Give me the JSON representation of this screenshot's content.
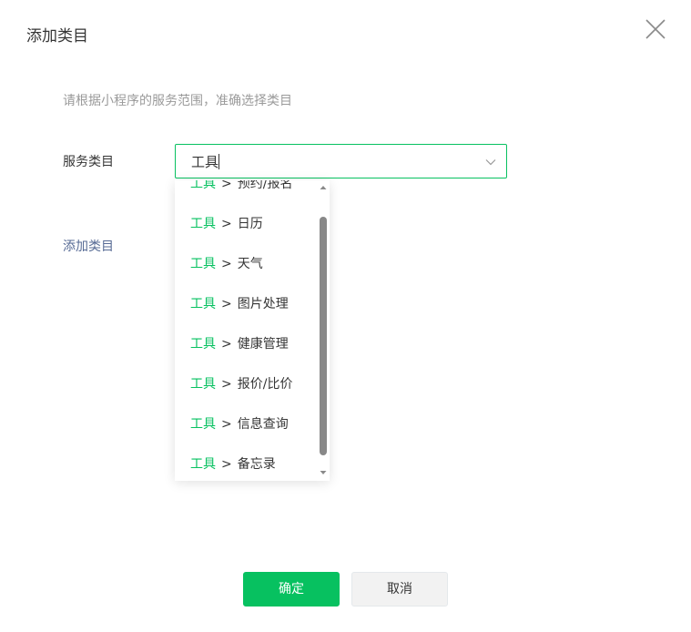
{
  "dialog": {
    "title": "添加类目",
    "hint": "请根据小程序的服务范围，准确选择类目",
    "field_label": "服务类目",
    "add_link": "添加类目"
  },
  "search": {
    "value": "工具"
  },
  "dropdown": {
    "items": [
      {
        "prefix": "工具",
        "sep": ">",
        "label": "预约/报名"
      },
      {
        "prefix": "工具",
        "sep": ">",
        "label": "日历"
      },
      {
        "prefix": "工具",
        "sep": ">",
        "label": "天气"
      },
      {
        "prefix": "工具",
        "sep": ">",
        "label": "图片处理"
      },
      {
        "prefix": "工具",
        "sep": ">",
        "label": "健康管理"
      },
      {
        "prefix": "工具",
        "sep": ">",
        "label": "报价/比价"
      },
      {
        "prefix": "工具",
        "sep": ">",
        "label": "信息查询"
      },
      {
        "prefix": "工具",
        "sep": ">",
        "label": "备忘录"
      }
    ]
  },
  "buttons": {
    "confirm": "确定",
    "cancel": "取消"
  },
  "colors": {
    "accent": "#07c160",
    "link": "#576b95",
    "hint": "#9a9a9a"
  },
  "icons": {
    "close": "close-icon",
    "dropdown": "chevron-down-icon"
  }
}
